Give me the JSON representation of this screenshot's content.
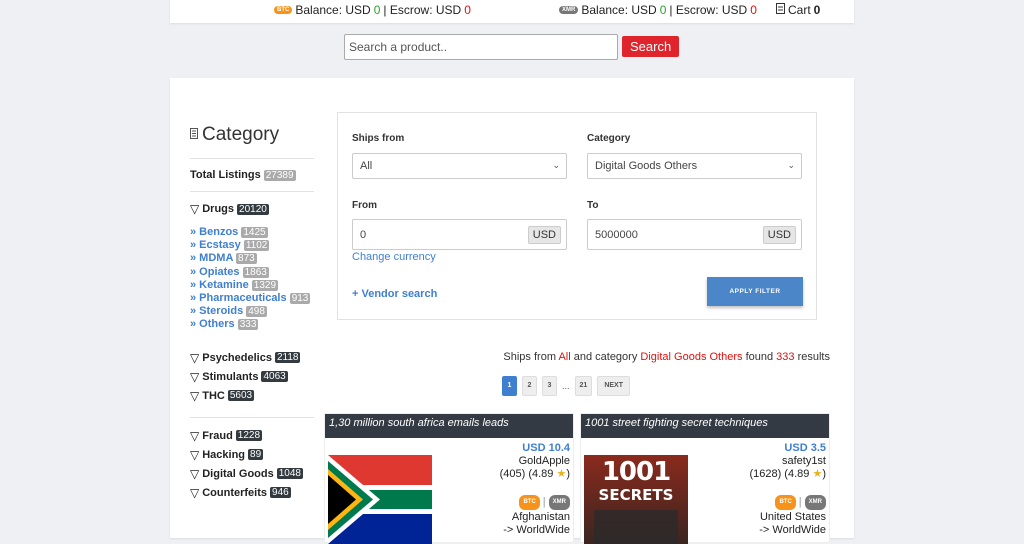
{
  "topbar": {
    "btc_badge": "BTC",
    "btc_balance_label": "Balance: USD",
    "btc_balance_value": "0",
    "btc_escrow_label": "| Escrow: USD",
    "btc_escrow_value": "0",
    "xmr_badge": "XMR",
    "xmr_balance_label": "Balance: USD",
    "xmr_balance_value": "0",
    "xmr_escrow_label": "| Escrow: USD",
    "xmr_escrow_value": "0",
    "cart_label": "Cart",
    "cart_count": "0"
  },
  "search": {
    "placeholder": "Search a product..",
    "button_label": "Search"
  },
  "sidebar": {
    "title": "Category",
    "total_label": "Total Listings",
    "total_count": "27389",
    "drugs": {
      "label": "Drugs",
      "count": "20120",
      "subs": [
        {
          "label": "» Benzos",
          "count": "1425"
        },
        {
          "label": "» Ecstasy",
          "count": "1102"
        },
        {
          "label": "» MDMA",
          "count": "873"
        },
        {
          "label": "» Opiates",
          "count": "1863"
        },
        {
          "label": "» Ketamine",
          "count": "1329"
        },
        {
          "label": "» Pharmaceuticals",
          "count": "913"
        },
        {
          "label": "» Steroids",
          "count": "498"
        },
        {
          "label": "» Others",
          "count": "333"
        }
      ]
    },
    "groups": [
      {
        "label": "Psychedelics",
        "count": "2118"
      },
      {
        "label": "Stimulants",
        "count": "4063"
      },
      {
        "label": "THC",
        "count": "5603"
      }
    ],
    "groups2": [
      {
        "label": "Fraud",
        "count": "1228"
      },
      {
        "label": "Hacking",
        "count": "89"
      },
      {
        "label": "Digital Goods",
        "count": "1048"
      },
      {
        "label": "Counterfeits",
        "count": "946"
      }
    ]
  },
  "filter": {
    "ships_from_label": "Ships from",
    "ships_from_value": "All",
    "category_label": "Category",
    "category_value": "Digital Goods Others",
    "from_label": "From",
    "from_value": "0",
    "to_label": "To",
    "to_value": "5000000",
    "currency": "USD",
    "change_currency": "Change currency",
    "vendor_search": "+ Vendor search",
    "apply_label": "APPLY FILTER"
  },
  "results": {
    "prefix": "Ships from",
    "ships_from": "All",
    "mid": "and category",
    "category": "Digital Goods Others",
    "found": "found",
    "count": "333",
    "suffix": "results"
  },
  "pagination": {
    "pages": [
      "1",
      "2",
      "3"
    ],
    "ellipsis": "...",
    "last": "21",
    "next": "NEXT"
  },
  "listings": [
    {
      "title": "1,30 million south africa emails leads",
      "price": "USD 10.4",
      "vendor": "GoldApple",
      "rating": "(405) (4.89",
      "star": "★",
      "rating_end": ")",
      "coin1": "BTC",
      "coin2": "XMR",
      "origin": "Afghanistan",
      "dest": "-> WorldWide"
    },
    {
      "title": "1001 street fighting secret techniques",
      "price": "USD 3.5",
      "vendor": "safety1st",
      "rating": "(1628) (4.89",
      "star": "★",
      "rating_end": ")",
      "coin1": "BTC",
      "coin2": "XMR",
      "origin": "United States",
      "dest": "-> WorldWide",
      "cover_line1": "1001",
      "cover_line2": "SECRETS"
    }
  ],
  "colors": {
    "accent": "#3f7fd0",
    "search_red": "#e0242c",
    "header_dark": "#343a43",
    "balance_green": "#2e9e2e",
    "balance_red": "#e01010"
  }
}
